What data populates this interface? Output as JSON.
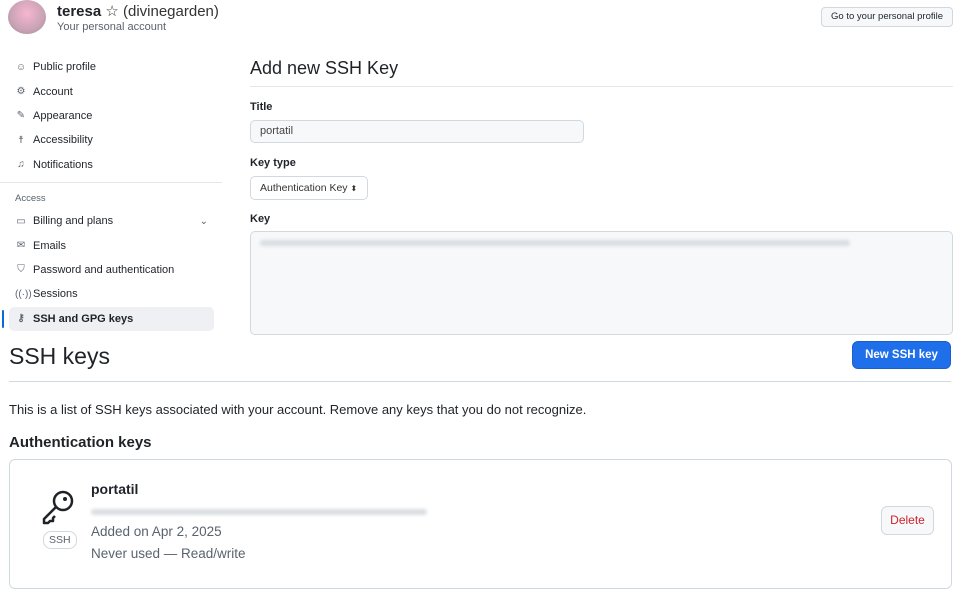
{
  "user": {
    "name": "teresa",
    "star": "☆",
    "handle": "(divinegarden)",
    "subtitle": "Your personal account",
    "profile_button": "Go to your personal profile"
  },
  "sidebar": {
    "items": [
      {
        "label": "Public profile",
        "icon": "person-icon"
      },
      {
        "label": "Account",
        "icon": "gear-icon"
      },
      {
        "label": "Appearance",
        "icon": "paintbrush-icon"
      },
      {
        "label": "Accessibility",
        "icon": "accessibility-icon"
      },
      {
        "label": "Notifications",
        "icon": "bell-icon"
      }
    ],
    "section": "Access",
    "access_items": [
      {
        "label": "Billing and plans",
        "icon": "credit-card-icon"
      },
      {
        "label": "Emails",
        "icon": "mail-icon"
      },
      {
        "label": "Password and authentication",
        "icon": "shield-icon"
      },
      {
        "label": "Sessions",
        "icon": "broadcast-icon"
      },
      {
        "label": "SSH and GPG keys",
        "icon": "key-icon",
        "active": true
      }
    ]
  },
  "add_form": {
    "heading": "Add new SSH Key",
    "title_label": "Title",
    "title_value": "portatil",
    "key_type_label": "Key type",
    "key_type_value": "Authentication Key",
    "key_label": "Key"
  },
  "ssh": {
    "heading": "SSH keys",
    "new_button": "New SSH key",
    "description": "This is a list of SSH keys associated with your account. Remove any keys that you do not recognize.",
    "auth_heading": "Authentication keys",
    "keys": [
      {
        "title": "portatil",
        "badge": "SSH",
        "added": "Added on Apr 2, 2025",
        "usage": "Never used — Read/write",
        "delete": "Delete"
      }
    ]
  },
  "colors": {
    "primary": "#1f6feb",
    "danger": "#cf222e",
    "active_indicator": "#0969da"
  }
}
